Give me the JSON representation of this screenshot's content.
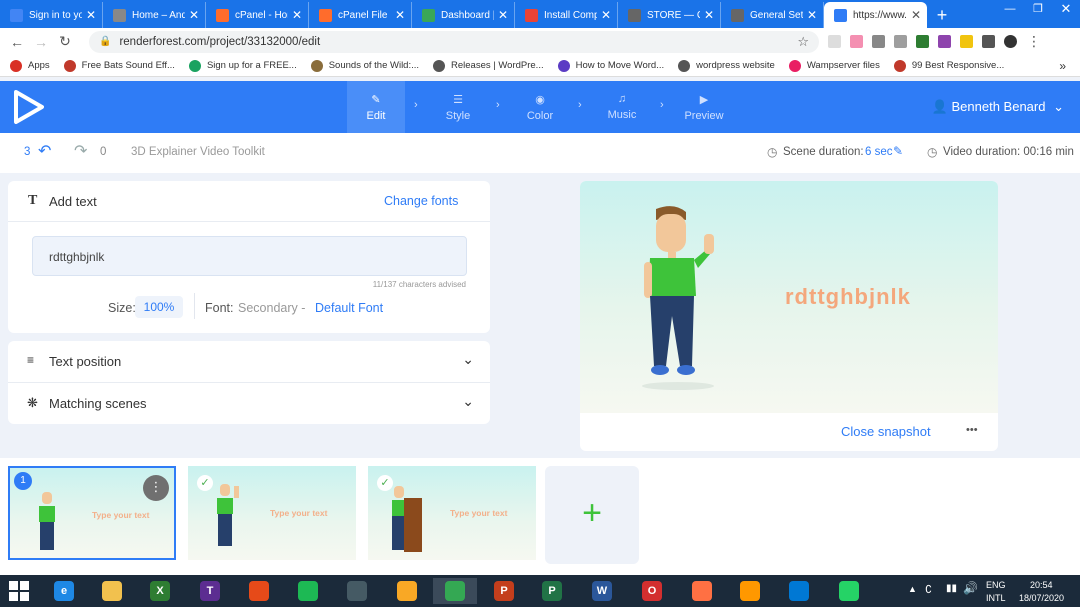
{
  "browser": {
    "tabs": [
      {
        "title": "Sign in to yo",
        "color": "#4285f4"
      },
      {
        "title": "Home – And",
        "color": "#888888"
      },
      {
        "title": "cPanel - Hom",
        "color": "#ff6c2c"
      },
      {
        "title": "cPanel File M",
        "color": "#ff6c2c"
      },
      {
        "title": "Dashboard |",
        "color": "#3aa757"
      },
      {
        "title": "Install Comp",
        "color": "#ea4335"
      },
      {
        "title": "STORE — Co",
        "color": "#666666"
      },
      {
        "title": "General Setti",
        "color": "#666666"
      },
      {
        "title": "https://www.",
        "color": "#2f7cf6"
      }
    ],
    "new_tab": "+",
    "url": "renderforest.com/project/33132000/edit",
    "bookmarks": [
      {
        "label": "Apps",
        "color": "#d93025"
      },
      {
        "label": "Free Bats Sound Eff...",
        "color": "#c0392b"
      },
      {
        "label": "Sign up for a FREE...",
        "color": "#1aa260"
      },
      {
        "label": "Sounds of the Wild:...",
        "color": "#8a6d3b"
      },
      {
        "label": "Releases | WordPre...",
        "color": "#555555"
      },
      {
        "label": "How to Move Word...",
        "color": "#5b3cc4"
      },
      {
        "label": "wordpress website",
        "color": "#555555"
      },
      {
        "label": "Wampserver files",
        "color": "#e91e63"
      },
      {
        "label": "99 Best Responsive...",
        "color": "#c0392b"
      }
    ],
    "bookmarks_more": "»"
  },
  "app": {
    "steps": [
      {
        "label": "Edit",
        "icon": "pencil-icon",
        "active": true
      },
      {
        "label": "Style",
        "icon": "layers-icon"
      },
      {
        "label": "Color",
        "icon": "palette-icon"
      },
      {
        "label": "Music",
        "icon": "music-icon"
      },
      {
        "label": "Preview",
        "icon": "play-icon"
      }
    ],
    "user_name": "Benneth Benard",
    "undo_count": "3",
    "redo_count": "0",
    "project_title": "3D Explainer Video Toolkit",
    "scene_duration_label": "Scene duration:",
    "scene_duration_value": "6 sec",
    "video_duration": "Video duration: 00:16 min"
  },
  "editor": {
    "add_text_label": "Add text",
    "change_fonts": "Change fonts",
    "text_value": "rdttghbjnlk",
    "char_hint": "11/137 characters advised",
    "size_label": "Size:",
    "size_value": "100%",
    "font_label": "Font:",
    "font_secondary": "Secondary -",
    "font_default": "Default Font",
    "text_position_label": "Text position",
    "matching_scenes_label": "Matching scenes"
  },
  "preview": {
    "scene_text": "rdttghbjnlk",
    "close_snapshot": "Close snapshot",
    "more": "•••"
  },
  "thumbnails": [
    {
      "text": "Type your text",
      "number": "1",
      "selected": true
    },
    {
      "text": "Type your text",
      "checked": true
    },
    {
      "text": "Type your text",
      "checked": true
    }
  ],
  "add_scene": "+",
  "taskbar": {
    "lang": "ENG",
    "layout": "INTL",
    "time": "20:54",
    "date": "18/07/2020"
  }
}
